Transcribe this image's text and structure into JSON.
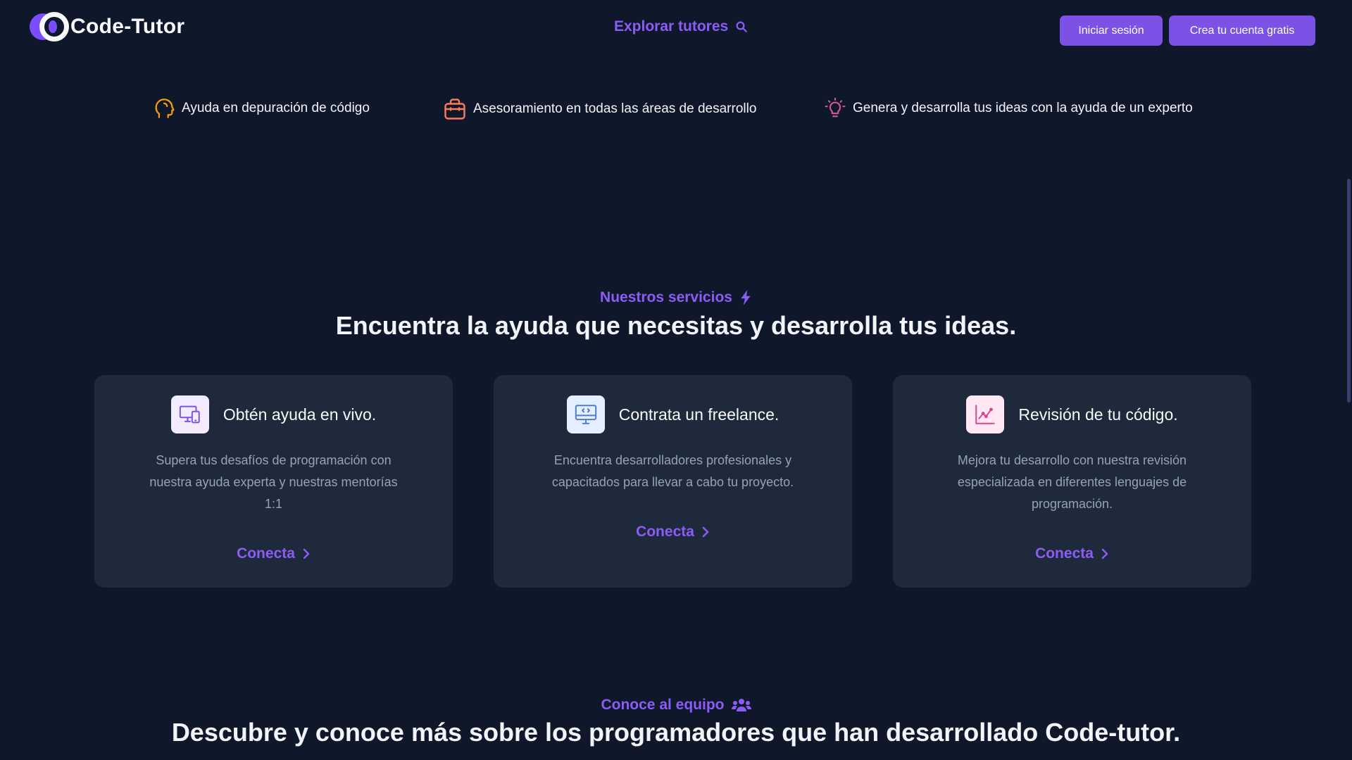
{
  "nav": {
    "logo_text": "Code-Tutor",
    "explore_label": "Explorar tutores",
    "login_label": "Iniciar sesión",
    "signup_label": "Crea tu cuenta gratis"
  },
  "features": [
    {
      "label": "Ayuda en depuración de código",
      "icon": "head-icon"
    },
    {
      "label": "Asesoramiento en todas las áreas de desarrollo",
      "icon": "briefcase-icon"
    },
    {
      "label": "Genera y desarrolla tus ideas con la ayuda de un experto",
      "icon": "lightbulb-icon"
    }
  ],
  "services": {
    "eyebrow": "Nuestros servicios",
    "headline": "Encuentra la ayuda que necesitas y desarrolla tus ideas.",
    "cards": [
      {
        "title": "Obtén ayuda en vivo.",
        "description": "Supera tus desafíos de programación con nuestra ayuda experta y nuestras mentorías 1:1",
        "link": "Conecta",
        "icon": "devices-icon"
      },
      {
        "title": "Contrata un freelance.",
        "description": "Encuentra desarrolladores profesionales y capacitados para llevar a cabo tu proyecto.",
        "link": "Conecta",
        "icon": "monitor-code-icon"
      },
      {
        "title": "Revisión de tu código.",
        "description": "Mejora tu desarrollo con nuestra revisión especializada en diferentes lenguajes de programación.",
        "link": "Conecta",
        "icon": "chart-line-icon"
      }
    ]
  },
  "team": {
    "eyebrow": "Conoce al equipo",
    "headline": "Descubre y conoce más sobre los programadores que han desarrollado Code-tutor."
  },
  "colors": {
    "background": "#0f172a",
    "card": "#1e293b",
    "accent": "#8b5cf6",
    "button": "#7c52e6"
  }
}
